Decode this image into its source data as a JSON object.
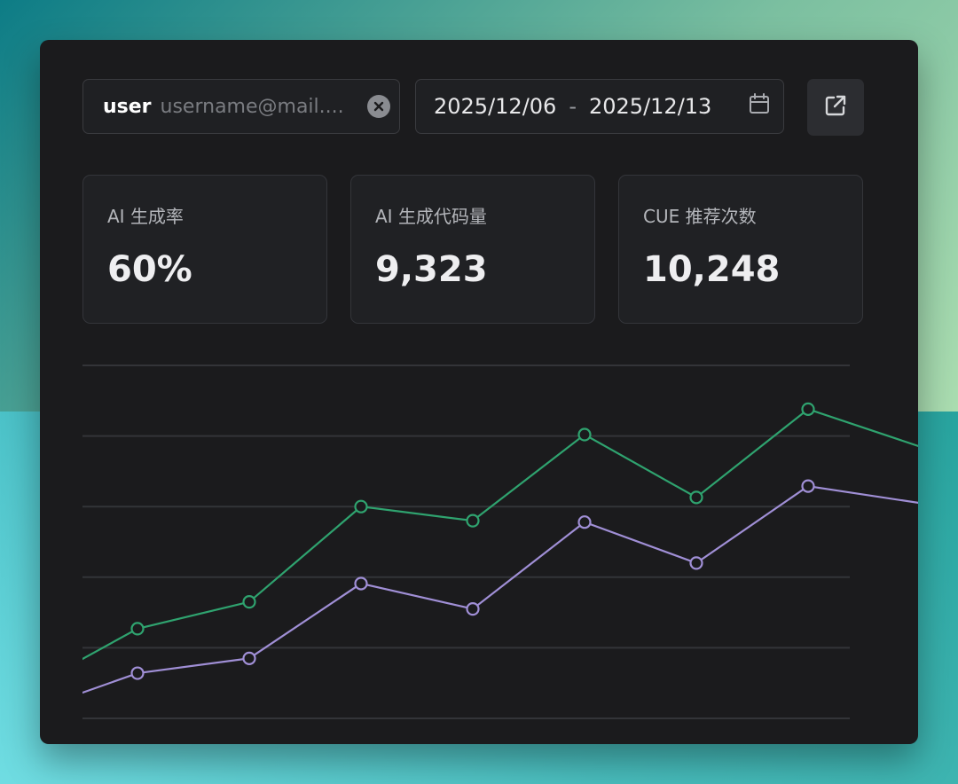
{
  "filters": {
    "user_label": "user",
    "user_value": "username@mail....",
    "date_start": "2025/12/06",
    "date_separator": "-",
    "date_end": "2025/12/13"
  },
  "icons": {
    "clear": "close-circle-icon",
    "calendar": "calendar-icon",
    "export": "external-link-icon"
  },
  "metrics": [
    {
      "title": "AI 生成率",
      "value": "60%"
    },
    {
      "title": "AI 生成代码量",
      "value": "9,323"
    },
    {
      "title": "CUE 推荐次数",
      "value": "10,248"
    }
  ],
  "colors": {
    "series_green": "#2fa36f",
    "series_purple": "#a08fd6",
    "panel_bg": "#1b1b1d"
  },
  "chart_data": {
    "type": "line",
    "x": [
      0,
      1,
      2,
      3,
      4,
      5,
      6,
      7,
      8
    ],
    "grid": true,
    "ylim": [
      0,
      5
    ],
    "series": [
      {
        "values": [
          0.4,
          1.27,
          1.65,
          3.0,
          2.8,
          4.02,
          3.13,
          4.38,
          3.85
        ],
        "color": "#2fa36f"
      },
      {
        "values": [
          0.08,
          0.64,
          0.85,
          1.91,
          1.55,
          2.78,
          2.2,
          3.29,
          3.05
        ],
        "color": "#a08fd6"
      }
    ],
    "markers_visible_on": [
      1,
      2,
      3,
      4,
      5,
      6,
      7
    ]
  }
}
